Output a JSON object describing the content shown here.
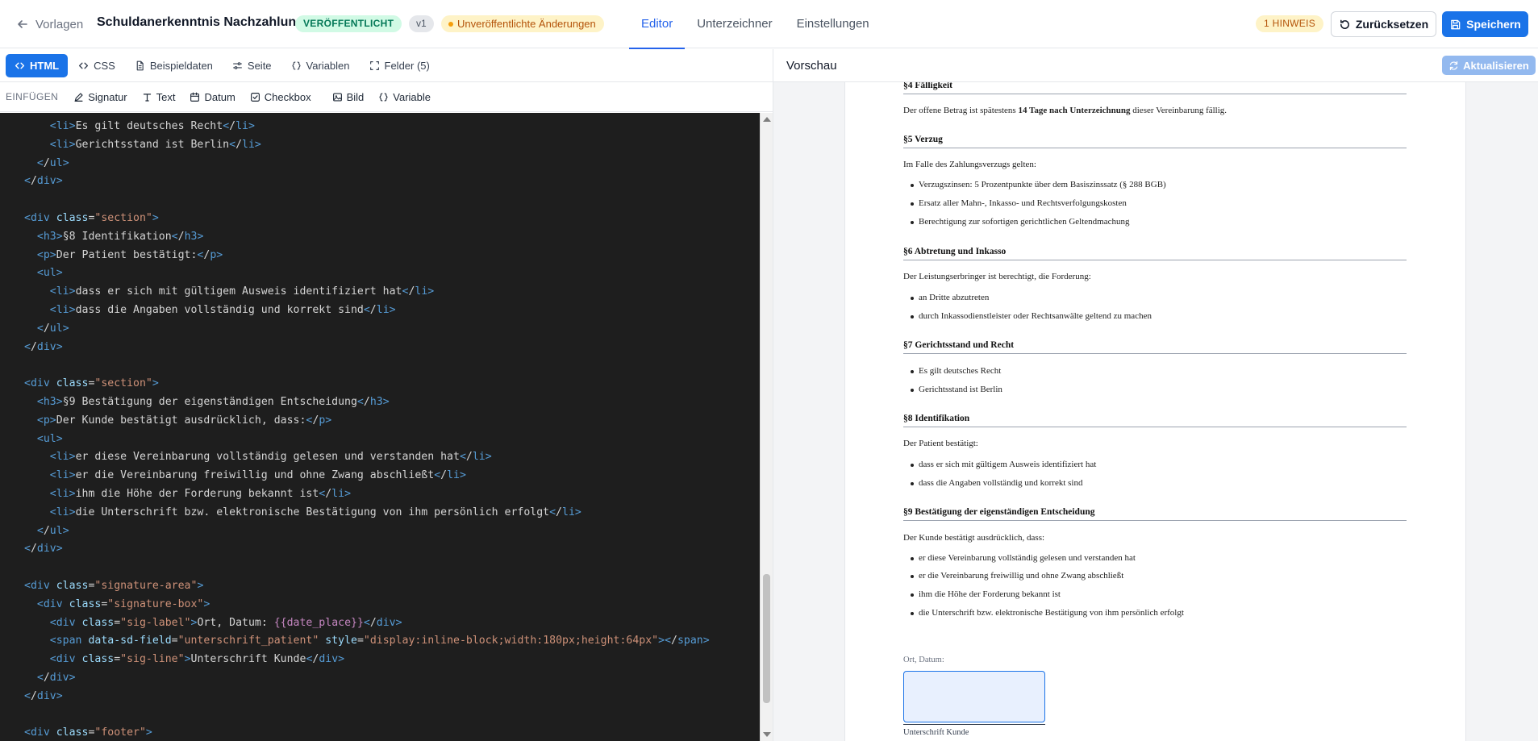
{
  "header": {
    "back_label": "Vorlagen",
    "title": "Schuldanerkenntnis Nachzahlung",
    "status_badge": "VERÖFFENTLICHT",
    "version_badge": "v1",
    "unpublished_badge": "Unveröffentlichte Änderungen",
    "tabs": [
      {
        "label": "Editor",
        "active": true
      },
      {
        "label": "Unterzeichner",
        "active": false
      },
      {
        "label": "Einstellungen",
        "active": false
      }
    ],
    "hint_badge": "1 HINWEIS",
    "reset_label": "Zurücksetzen",
    "save_label": "Speichern"
  },
  "editor": {
    "tabs": [
      {
        "label": "HTML",
        "icon": "code-icon",
        "active": true
      },
      {
        "label": "CSS",
        "icon": "code-icon",
        "active": false
      },
      {
        "label": "Beispieldaten",
        "icon": "file-icon",
        "active": false
      },
      {
        "label": "Seite",
        "icon": "settings-icon",
        "active": false
      },
      {
        "label": "Variablen",
        "icon": "braces-icon",
        "active": false
      },
      {
        "label": "Felder (5)",
        "icon": "fields-icon",
        "active": false
      }
    ],
    "insert_label": "EINFÜGEN",
    "insert_buttons": [
      {
        "label": "Signatur",
        "icon": "pen-icon"
      },
      {
        "label": "Text",
        "icon": "text-icon"
      },
      {
        "label": "Datum",
        "icon": "calendar-icon"
      },
      {
        "label": "Checkbox",
        "icon": "checkbox-icon"
      },
      {
        "label": "Bild",
        "icon": "image-icon"
      },
      {
        "label": "Variable",
        "icon": "braces-icon"
      }
    ],
    "code_lines": [
      "    <li>Es gilt deutsches Recht</li>",
      "    <li>Gerichtsstand ist Berlin</li>",
      "  </ul>",
      "</div>",
      "",
      "<div class=\"section\">",
      "  <h3>§8 Identifikation</h3>",
      "  <p>Der Patient bestätigt:</p>",
      "  <ul>",
      "    <li>dass er sich mit gültigem Ausweis identifiziert hat</li>",
      "    <li>dass die Angaben vollständig und korrekt sind</li>",
      "  </ul>",
      "</div>",
      "",
      "<div class=\"section\">",
      "  <h3>§9 Bestätigung der eigenständigen Entscheidung</h3>",
      "  <p>Der Kunde bestätigt ausdrücklich, dass:</p>",
      "  <ul>",
      "    <li>er diese Vereinbarung vollständig gelesen und verstanden hat</li>",
      "    <li>er die Vereinbarung freiwillig und ohne Zwang abschließt</li>",
      "    <li>ihm die Höhe der Forderung bekannt ist</li>",
      "    <li>die Unterschrift bzw. elektronische Bestätigung von ihm persönlich erfolgt</li>",
      "  </ul>",
      "</div>",
      "",
      "<div class=\"signature-area\">",
      "  <div class=\"signature-box\">",
      "    <div class=\"sig-label\">Ort, Datum: {{date_place}}</div>",
      "    <span data-sd-field=\"unterschrift_patient\" style=\"display:inline-block;width:180px;height:64px\"></span>",
      "    <div class=\"sig-line\">Unterschrift Kunde</div>",
      "  </div>",
      "</div>",
      "",
      "<div class=\"footer\">"
    ]
  },
  "preview": {
    "title": "Vorschau",
    "refresh_label": "Aktualisieren",
    "sections": [
      {
        "heading": "§4 Fälligkeit",
        "para_before": "Der offene Betrag ist spätestens ",
        "para_bold": "14 Tage nach Unterzeichnung",
        "para_after": " dieser Vereinbarung fällig.",
        "items": []
      },
      {
        "heading": "§5 Verzug",
        "para": "Im Falle des Zahlungsverzugs gelten:",
        "items": [
          "Verzugszinsen: 5 Prozentpunkte über dem Basiszinssatz (§ 288 BGB)",
          "Ersatz aller Mahn-, Inkasso- und Rechtsverfolgungskosten",
          "Berechtigung zur sofortigen gerichtlichen Geltendmachung"
        ]
      },
      {
        "heading": "§6 Abtretung und Inkasso",
        "para": "Der Leistungserbringer ist berechtigt, die Forderung:",
        "items": [
          "an Dritte abzutreten",
          "durch Inkassodienstleister oder Rechtsanwälte geltend zu machen"
        ]
      },
      {
        "heading": "§7 Gerichtsstand und Recht",
        "para": "",
        "items": [
          "Es gilt deutsches Recht",
          "Gerichtsstand ist Berlin"
        ]
      },
      {
        "heading": "§8 Identifikation",
        "para": "Der Patient bestätigt:",
        "items": [
          "dass er sich mit gültigem Ausweis identifiziert hat",
          "dass die Angaben vollständig und korrekt sind"
        ]
      },
      {
        "heading": "§9 Bestätigung der eigenständigen Entscheidung",
        "para": "Der Kunde bestätigt ausdrücklich, dass:",
        "items": [
          "er diese Vereinbarung vollständig gelesen und verstanden hat",
          "er die Vereinbarung freiwillig und ohne Zwang abschließt",
          "ihm die Höhe der Forderung bekannt ist",
          "die Unterschrift bzw. elektronische Bestätigung von ihm persönlich erfolgt"
        ]
      }
    ],
    "signature": {
      "place_label": "Ort, Datum:",
      "line_label": "Unterschrift Kunde"
    }
  },
  "colors": {
    "accent": "#1a73e8",
    "published": "#047857",
    "warning": "#b45309",
    "code_bg": "#1e1e1e"
  }
}
